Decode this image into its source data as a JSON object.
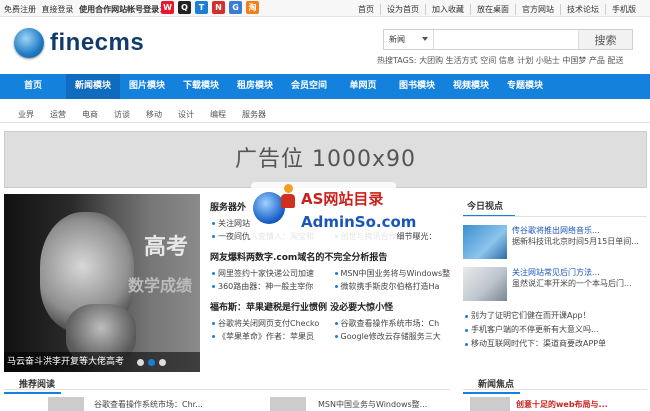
{
  "topbar": {
    "free_register": "免费注册",
    "direct_login": "直接登录",
    "partner_login": "使用合作网站帐号登录：",
    "socials": [
      {
        "name": "weibo",
        "glyph": "W",
        "color": "#e6162d"
      },
      {
        "name": "qq",
        "glyph": "Q",
        "color": "#222222"
      },
      {
        "name": "tencent-weibo",
        "glyph": "T",
        "color": "#1c7fd5"
      },
      {
        "name": "netease",
        "glyph": "N",
        "color": "#d3302b"
      },
      {
        "name": "google",
        "glyph": "G",
        "color": "#3a7bd5"
      },
      {
        "name": "taobao",
        "glyph": "淘",
        "color": "#f57e16"
      }
    ],
    "links": [
      "首页",
      "设为首页",
      "加入收藏",
      "放在桌面",
      "官方网站",
      "技术论坛",
      "手机版"
    ]
  },
  "header": {
    "logo_text": "finecms",
    "search_select": "新闻",
    "search_placeholder": "",
    "search_button": "搜索",
    "hot_tags": "热搜TAGS:  大团购 生活方式 空间 信息 计划 小贴士 中国梦 产品 配送"
  },
  "nav": [
    "首页",
    "新闻模块",
    "图片模块",
    "下载模块",
    "租房模块",
    "会员空间",
    "单网页",
    "图书模块",
    "视频模块",
    "专题模块"
  ],
  "subnav": [
    "业界",
    "运营",
    "电商",
    "访谈",
    "移动",
    "设计",
    "编程",
    "服务器"
  ],
  "ad": {
    "text": "广告位       1000x90"
  },
  "slideshow": {
    "caption": "马云奋斗洪李开复等大佬高考",
    "overlay_big": "高考",
    "overlay_small": "数学成绩"
  },
  "middle": {
    "block1": {
      "head": "服务器外",
      "rows": [
        [
          "关注网站",
          "arby页面"
        ],
        [
          "一夜间仇人变情人：淘宝和",
          "创世与腾讯合作细节曝光："
        ]
      ]
    },
    "block2": {
      "head": "网友爆料两数字.com域名的不完全分析报告",
      "rows": [
        [
          "网里签约十家快递公司加速",
          "MSN中国业务将与Windows整"
        ],
        [
          "360路由器：神一般主宰你",
          "微软携手斯皮尔伯格打造Ha"
        ]
      ]
    },
    "block3": {
      "head": "福布斯：苹果避税是行业惯例 没必要大惊小怪",
      "rows": [
        [
          "谷歌将关闭网页支付Checko",
          "谷歌查看操作系统市场：Ch"
        ],
        [
          "《苹果革命》作者：苹果员",
          "Google修改云存储服务三大"
        ]
      ]
    }
  },
  "watermark": {
    "line1": "AS网站目录",
    "line2": "AdminSo.com"
  },
  "right": {
    "title": "今日视点",
    "items": [
      {
        "head": "传谷歌将推出网络音乐...",
        "body": "据新科技讯北京时间5月15日单间..."
      },
      {
        "head": "关注网站常见后门方法...",
        "body": "虽然说汇率开米的一个本马后门..."
      }
    ],
    "list": [
      "别为了证明它们健在而开课App！",
      "手机客户端的不停更新有大意义吗...",
      "移动互联网时代下：渠道商要改APP单"
    ]
  },
  "bottom": {
    "recommend": "推荐阅读",
    "row_left": "谷歌查看操作系统市场：Chr...",
    "row_mid": "MSN中国业务与Windows整...",
    "focus": "新闻焦点",
    "focus_item": "创意十足的web布局与..."
  },
  "colors": {
    "accent": "#1482dc",
    "nav_active": "#0f6bbd",
    "logo": "#123b6b"
  }
}
